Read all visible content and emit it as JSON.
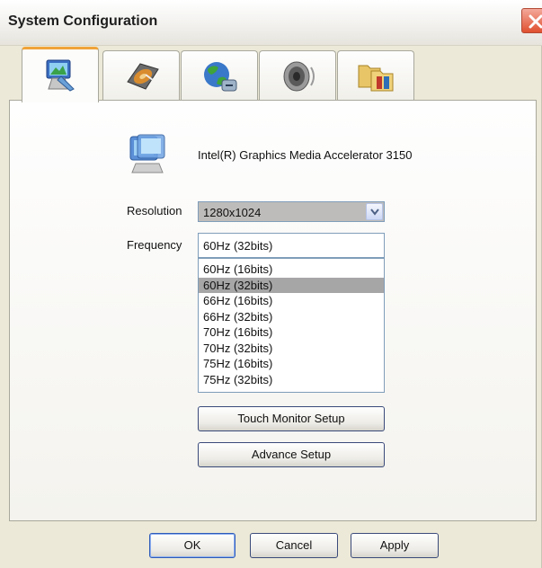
{
  "window": {
    "title": "System Configuration"
  },
  "tabs": [
    {
      "icon": "display-settings-icon",
      "active": true
    },
    {
      "icon": "hard-disk-icon",
      "active": false
    },
    {
      "icon": "network-globe-icon",
      "active": false
    },
    {
      "icon": "speaker-icon",
      "active": false
    },
    {
      "icon": "folders-icon",
      "active": false
    }
  ],
  "display": {
    "adapter_name": "Intel(R) Graphics Media Accelerator 3150",
    "resolution_label": "Resolution",
    "resolution_value": "1280x1024",
    "frequency_label": "Frequency",
    "frequency_value": "60Hz (32bits)",
    "frequency_options": [
      "60Hz (16bits)",
      "60Hz (32bits)",
      "66Hz (16bits)",
      "66Hz (32bits)",
      "70Hz (16bits)",
      "70Hz (32bits)",
      "75Hz (16bits)",
      "75Hz (32bits)"
    ],
    "highlighted_option": "60Hz (32bits)",
    "touch_monitor_setup_label": "Touch Monitor Setup",
    "advance_setup_label": "Advance Setup"
  },
  "footer": {
    "ok_label": "OK",
    "cancel_label": "Cancel",
    "apply_label": "Apply"
  },
  "colors": {
    "window_bg": "#ece9d8",
    "close_button": "#e0502f",
    "active_tab_accent": "#f0a43a",
    "highlight": "#a7a6a7"
  }
}
